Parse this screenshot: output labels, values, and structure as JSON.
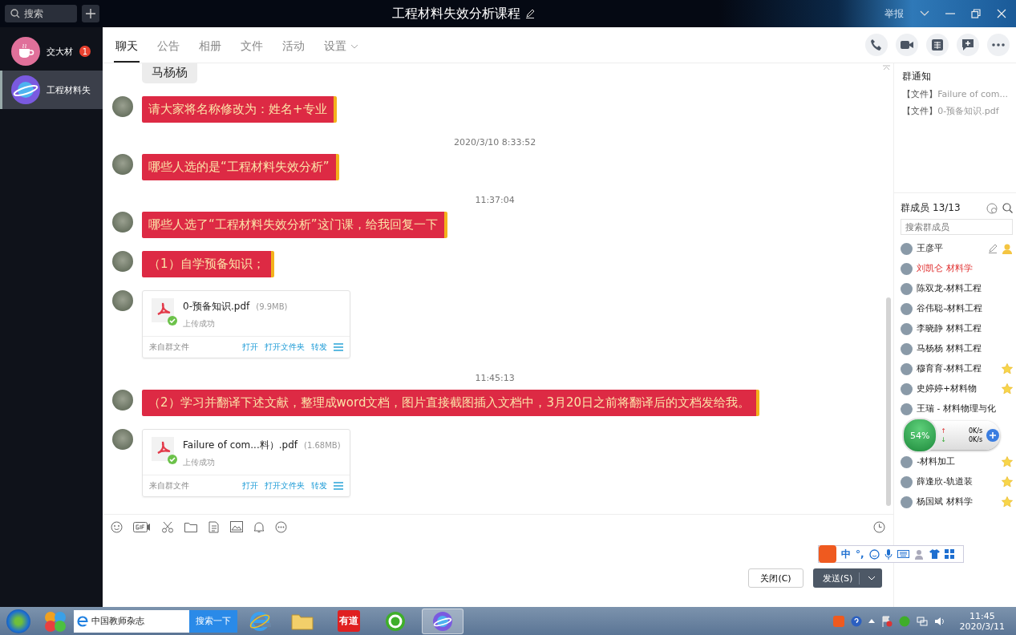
{
  "window": {
    "title": "工程材料失效分析课程",
    "report": "举报"
  },
  "search": {
    "placeholder": "搜索"
  },
  "conversations": [
    {
      "name": "交大材",
      "unread": "1",
      "kind": "cup",
      "selected": false
    },
    {
      "name": "工程材料失",
      "kind": "planet",
      "selected": true
    }
  ],
  "tabs": [
    {
      "label": "聊天",
      "selected": true
    },
    {
      "label": "公告",
      "selected": false
    },
    {
      "label": "相册",
      "selected": false
    },
    {
      "label": "文件",
      "selected": false
    },
    {
      "label": "活动",
      "selected": false
    },
    {
      "label": "设置",
      "selected": false,
      "dropdown": true
    }
  ],
  "messages": [
    {
      "kind": "plain",
      "text": "马杨杨"
    },
    {
      "kind": "text",
      "text": "请大家将名称修改为：姓名+专业"
    },
    {
      "kind": "time",
      "text": "2020/3/10 8:33:52"
    },
    {
      "kind": "text",
      "text": "哪些人选的是“工程材料失效分析”"
    },
    {
      "kind": "time",
      "text": "11:37:04"
    },
    {
      "kind": "text",
      "text": "哪些人选了“工程材料失效分析”这门课，给我回复一下"
    },
    {
      "kind": "text",
      "text": "（1）自学预备知识；"
    },
    {
      "kind": "file",
      "name": "0-预备知识.pdf",
      "size": "(9.9MB)",
      "status": "上传成功",
      "source": "来自群文件",
      "actions": [
        "打开",
        "打开文件夹",
        "转发"
      ]
    },
    {
      "kind": "time",
      "text": "11:45:13"
    },
    {
      "kind": "text",
      "text": "（2）学习并翻译下述文献，整理成word文档，图片直接截图插入文档中，3月20日之前将翻译后的文档发给我。"
    },
    {
      "kind": "file",
      "name": "Failure of com...料）.pdf",
      "size": "(1.68MB)",
      "status": "上传成功",
      "source": "来自群文件",
      "actions": [
        "打开",
        "打开文件夹",
        "转发"
      ]
    }
  ],
  "notice": {
    "title": "群通知",
    "items": [
      {
        "tag": "【文件】",
        "text": "Failure of com..."
      },
      {
        "tag": "【文件】",
        "text": "0-预备知识.pdf"
      }
    ]
  },
  "members_title": "群成员 13/13",
  "member_search": {
    "placeholder": "搜索群成员"
  },
  "members": [
    {
      "name": "王彦平",
      "highlighted": false,
      "admin": true,
      "starred": false
    },
    {
      "name": "刘凯仑  材料学",
      "highlighted": true,
      "admin": false,
      "starred": false
    },
    {
      "name": "陈双龙-材料工程",
      "highlighted": false,
      "admin": false,
      "starred": false
    },
    {
      "name": "谷伟聪–材料工程",
      "highlighted": false,
      "admin": false,
      "starred": false
    },
    {
      "name": "李晓静   材料工程",
      "highlighted": false,
      "admin": false,
      "starred": false
    },
    {
      "name": "马杨杨 材料工程",
      "highlighted": false,
      "admin": false,
      "starred": false
    },
    {
      "name": "穆育育-材料工程",
      "highlighted": false,
      "admin": false,
      "starred": true
    },
    {
      "name": "史婷婷+材料物",
      "highlighted": false,
      "admin": false,
      "starred": true
    },
    {
      "name": "王瑞 - 材料物理与化",
      "highlighted": false,
      "admin": false,
      "starred": false
    },
    {
      "name": "-材料加工",
      "highlighted": false,
      "admin": false,
      "starred": true
    },
    {
      "name": "薛逢欣-轨道装",
      "highlighted": false,
      "admin": false,
      "starred": true
    },
    {
      "name": "杨国斌 材料学",
      "highlighted": false,
      "admin": false,
      "starred": true
    }
  ],
  "net_widget": {
    "percent": "54%",
    "up_arrow": "↑",
    "up": "0K/s",
    "down_arrow": "↓",
    "down": "0K/s"
  },
  "ime": {
    "mode": "中",
    "punct": "°,"
  },
  "buttons": {
    "close": "关闭(C)",
    "send": "发送(S)"
  },
  "taskbar": {
    "search_text": "中国教师杂志",
    "search_button": "搜索一下",
    "app_label": "有道",
    "time": "11:45",
    "date": "2020/3/11"
  }
}
